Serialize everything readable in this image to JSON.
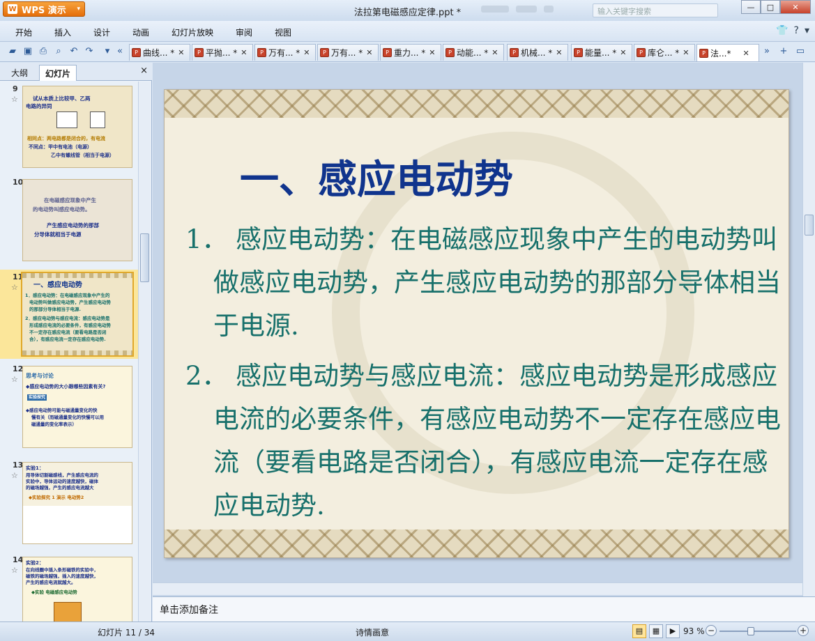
{
  "app": {
    "name": "WPS 演示",
    "doc_title": "法拉第电磁感应定律.ppt *",
    "search_placeholder": "输入关键字搜索"
  },
  "menu": [
    "开始",
    "插入",
    "设计",
    "动画",
    "幻灯片放映",
    "审阅",
    "视图"
  ],
  "tabs": [
    {
      "label": "曲线... *"
    },
    {
      "label": "平抛... *"
    },
    {
      "label": "万有... *"
    },
    {
      "label": "万有... *"
    },
    {
      "label": "重力... *"
    },
    {
      "label": "动能... *"
    },
    {
      "label": "机械... *"
    },
    {
      "label": "能量... *"
    },
    {
      "label": "库仑... *"
    },
    {
      "label": "法...*",
      "active": true
    }
  ],
  "left_panel": {
    "tab_outline": "大纲",
    "tab_slides": "幻灯片",
    "close": "×",
    "thumbs": [
      {
        "num": "9",
        "lines": [
          "试从本质上比较甲、乙两",
          "电路的异同",
          "相同点：两电路都是闭合的，有电流",
          "不同点：甲中有电池（电源）",
          "乙中有螺线管（相当于电源）"
        ]
      },
      {
        "num": "10",
        "lines": [
          "在电磁感应现象中产生",
          "的电动势叫感应电动势。",
          "产生感应电动势的那部",
          "分导体就相当于电源"
        ]
      },
      {
        "num": "11",
        "lines": [
          "一、感应电动势",
          "1．感应电动势：在电磁感应现象中产生的",
          "电动势叫做感应电动势，产生感应电动势",
          "的那部分导体相当于电源.",
          "2．感应电动势与感应电流：感应电动势是",
          "形成感应电流的必要条件，有感应电动势",
          "不一定存在感应电流（要看电路是否闭",
          "合），有感应电流一定存在感应电动势."
        ]
      },
      {
        "num": "12",
        "lines": [
          "思考与讨论",
          "◆感应电动势的大小跟哪些因素有关?",
          "实验探究",
          "◆感应电动势可能与磁通量变化的快",
          "慢有关（而磁通量变化的快慢可以用",
          "磁通量的变化率表示）"
        ]
      },
      {
        "num": "13",
        "lines": [
          "实验1：",
          "用导体切割磁感线，产生感应电流的",
          "实验中，导体运动的速度越快，磁体",
          "的磁场越强，产生的感应电流越大",
          "◆实验探究 1 演示 电动势2"
        ]
      },
      {
        "num": "14",
        "lines": [
          "实验2：",
          "在向线圈中插入条形磁铁的实验中，",
          "磁铁的磁场越强，插入的速度越快，",
          "产生的感应电流就越大。",
          "◆实验 电磁感应电动势"
        ]
      }
    ]
  },
  "slide": {
    "title": "一、感应电动势",
    "p1_num": "1．",
    "p1_body": "感应电动势：在电磁感应现象中产生的电动势叫做感应电动势，产生感应电动势的那部分导体相当于电源.",
    "p2_num": "2．",
    "p2_body": "感应电动势与感应电流：感应电动势是形成感应电流的必要条件，有感应电动势不一定存在感应电流（要看电路是否闭合），有感应电流一定存在感应电动势."
  },
  "notes": "单击添加备注",
  "status": {
    "page": "幻灯片 11 / 34",
    "theme": "诗情画意",
    "zoom": "93 %"
  }
}
